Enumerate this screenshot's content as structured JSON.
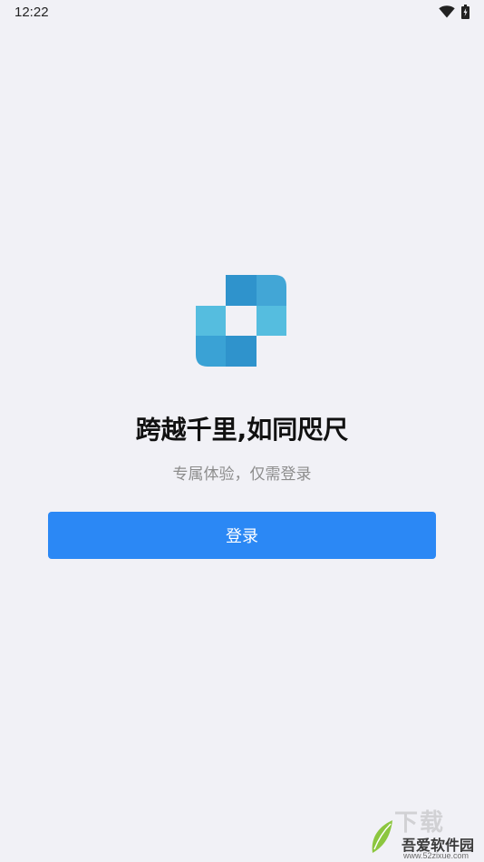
{
  "status_bar": {
    "time": "12:22",
    "icons": [
      "wifi-icon",
      "battery-icon"
    ]
  },
  "logo": {
    "icon": "app-logo-icon",
    "colors": [
      "#2f93cc",
      "#42a6d6",
      "#55bddf",
      "#3aa2d5"
    ]
  },
  "headline": "跨越千里,如同咫尺",
  "subtitle": "专属体验，仅需登录",
  "login_button": {
    "label": "登录",
    "color": "#2b88f5"
  },
  "watermark": {
    "ghost_text": "下载",
    "brand": "吾爱软件园",
    "url": "www.52zixue.com"
  }
}
